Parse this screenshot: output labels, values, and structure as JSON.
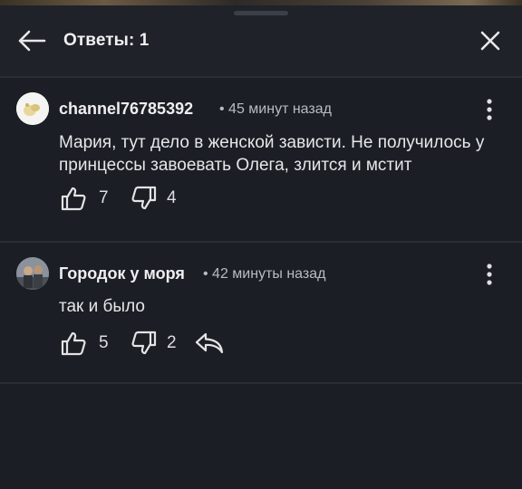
{
  "header": {
    "title": "Ответы: 1"
  },
  "comments": [
    {
      "author": "channel76785392",
      "time": "• 45 минут назад",
      "text": "Мария, тут дело в женской зависти. Не получилось у принцессы завоевать Олега, злится и мстит",
      "likes": "7",
      "dislikes": "4"
    },
    {
      "author": "Городок у моря",
      "time": "• 42 минуты назад",
      "text": "так и было",
      "likes": "5",
      "dislikes": "2"
    }
  ],
  "icons": [
    "back-arrow-icon",
    "close-icon",
    "more-vertical-icon",
    "thumbs-up-icon",
    "thumbs-down-icon",
    "reply-icon"
  ],
  "colors": {
    "background": "#1b1e24",
    "header": "#1f2229",
    "divider": "#2a2d34",
    "text": "#e6e6e8",
    "meta": "#b9bcc2"
  }
}
